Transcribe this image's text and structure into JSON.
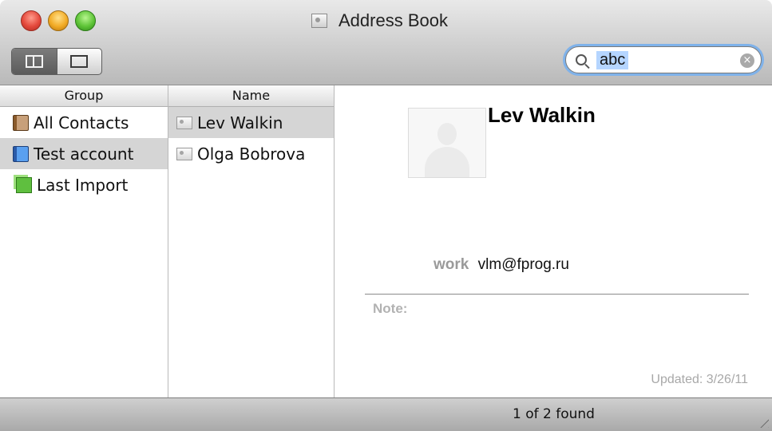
{
  "window": {
    "title": "Address Book"
  },
  "toolbar": {
    "search": {
      "value": "abc",
      "clear_symbol": "×"
    }
  },
  "columns": {
    "group_header": "Group",
    "name_header": "Name"
  },
  "groups": [
    {
      "label": "All Contacts",
      "icon": "address-book-icon",
      "selected": false
    },
    {
      "label": "Test account",
      "icon": "info-group-icon",
      "selected": true
    },
    {
      "label": "Last Import",
      "icon": "import-group-icon",
      "selected": false
    }
  ],
  "contacts": [
    {
      "name": "Lev Walkin",
      "selected": true
    },
    {
      "name": "Olga Bobrova",
      "selected": false
    }
  ],
  "card": {
    "name": "Lev Walkin",
    "email_label": "work",
    "email": "vlm@fprog.ru",
    "note_label": "Note:",
    "updated": "Updated: 3/26/11"
  },
  "status": {
    "found_text": "1 of 2 found"
  },
  "colors": {
    "selection": "#d5d5d5",
    "search_focus": "#7fb2ea"
  }
}
